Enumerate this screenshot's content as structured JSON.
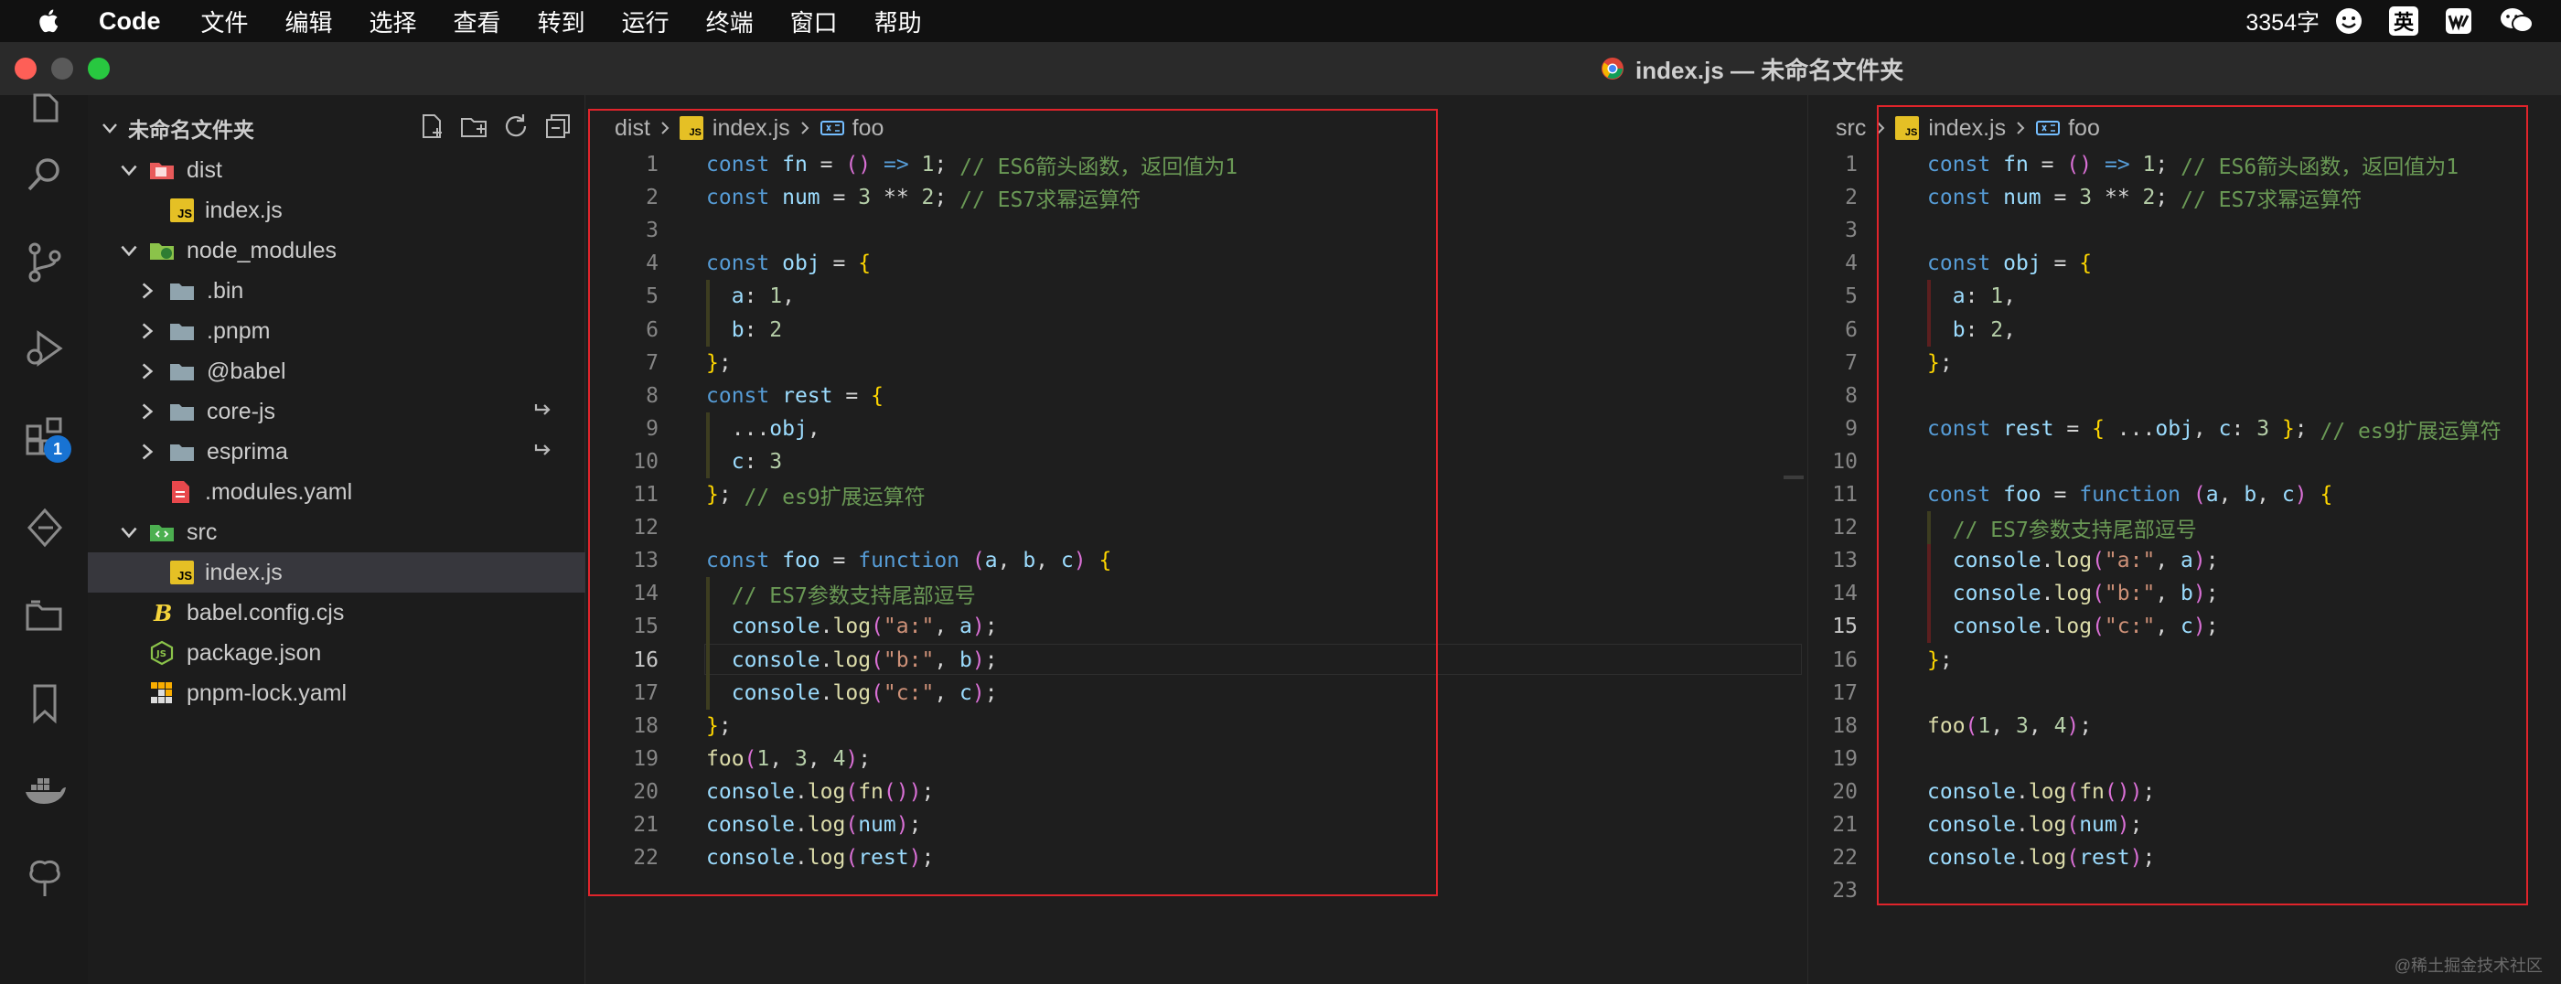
{
  "menubar": {
    "app": "Code",
    "items": [
      "文件",
      "编辑",
      "选择",
      "查看",
      "转到",
      "运行",
      "终端",
      "窗口",
      "帮助"
    ],
    "word_count": "3354字",
    "ime": "英"
  },
  "window": {
    "title": "index.js — 未命名文件夹"
  },
  "activity": {
    "badge": "1"
  },
  "explorer": {
    "title": "未命名文件夹",
    "tree": [
      {
        "label": "dist",
        "kind": "folder-dist",
        "expanded": true
      },
      {
        "label": "index.js",
        "kind": "js"
      },
      {
        "label": "node_modules",
        "kind": "folder-node",
        "expanded": true
      },
      {
        "label": ".bin",
        "kind": "folder"
      },
      {
        "label": ".pnpm",
        "kind": "folder"
      },
      {
        "label": "@babel",
        "kind": "folder"
      },
      {
        "label": "core-js",
        "kind": "folder"
      },
      {
        "label": "esprima",
        "kind": "folder"
      },
      {
        "label": ".modules.yaml",
        "kind": "yaml"
      },
      {
        "label": "src",
        "kind": "folder-src",
        "expanded": true
      },
      {
        "label": "index.js",
        "kind": "js"
      },
      {
        "label": "babel.config.cjs",
        "kind": "babel"
      },
      {
        "label": "package.json",
        "kind": "node"
      },
      {
        "label": "pnpm-lock.yaml",
        "kind": "pnpm"
      }
    ]
  },
  "left_editor": {
    "breadcrumb": {
      "folder": "dist",
      "file": "index.js",
      "symbol": "foo"
    },
    "active_line": "16",
    "lines": [
      {
        "n": "1",
        "code": "const fn = () => 1; // ES6箭头函数，返回值为1"
      },
      {
        "n": "2",
        "code": "const num = 3 ** 2; // ES7求幂运算符"
      },
      {
        "n": "3",
        "code": ""
      },
      {
        "n": "4",
        "code": "const obj = {"
      },
      {
        "n": "5",
        "code": "  a: 1,"
      },
      {
        "n": "6",
        "code": "  b: 2"
      },
      {
        "n": "7",
        "code": "};"
      },
      {
        "n": "8",
        "code": "const rest = {"
      },
      {
        "n": "9",
        "code": "  ...obj,"
      },
      {
        "n": "10",
        "code": "  c: 3"
      },
      {
        "n": "11",
        "code": "}; // es9扩展运算符"
      },
      {
        "n": "12",
        "code": ""
      },
      {
        "n": "13",
        "code": "const foo = function (a, b, c) {"
      },
      {
        "n": "14",
        "code": "  // ES7参数支持尾部逗号"
      },
      {
        "n": "15",
        "code": "  console.log(\"a:\", a);"
      },
      {
        "n": "16",
        "code": "  console.log(\"b:\", b);"
      },
      {
        "n": "17",
        "code": "  console.log(\"c:\", c);"
      },
      {
        "n": "18",
        "code": "};"
      },
      {
        "n": "19",
        "code": "foo(1, 3, 4);"
      },
      {
        "n": "20",
        "code": "console.log(fn());"
      },
      {
        "n": "21",
        "code": "console.log(num);"
      },
      {
        "n": "22",
        "code": "console.log(rest);"
      }
    ]
  },
  "right_editor": {
    "breadcrumb": {
      "folder": "src",
      "file": "index.js",
      "symbol": "foo"
    },
    "active_line": "15",
    "lines": [
      {
        "n": "1",
        "code": "const fn = () => 1; // ES6箭头函数，返回值为1"
      },
      {
        "n": "2",
        "code": "const num = 3 ** 2; // ES7求幂运算符"
      },
      {
        "n": "3",
        "code": ""
      },
      {
        "n": "4",
        "code": "const obj = {"
      },
      {
        "n": "5",
        "code": "  a: 1,"
      },
      {
        "n": "6",
        "code": "  b: 2,"
      },
      {
        "n": "7",
        "code": "};"
      },
      {
        "n": "8",
        "code": ""
      },
      {
        "n": "9",
        "code": "const rest = { ...obj, c: 3 }; // es9扩展运算符"
      },
      {
        "n": "10",
        "code": ""
      },
      {
        "n": "11",
        "code": "const foo = function (a, b, c) {"
      },
      {
        "n": "12",
        "code": "  // ES7参数支持尾部逗号"
      },
      {
        "n": "13",
        "code": "  console.log(\"a:\", a);"
      },
      {
        "n": "14",
        "code": "  console.log(\"b:\", b);"
      },
      {
        "n": "15",
        "code": "  console.log(\"c:\", c);"
      },
      {
        "n": "16",
        "code": "};"
      },
      {
        "n": "17",
        "code": ""
      },
      {
        "n": "18",
        "code": "foo(1, 3, 4);"
      },
      {
        "n": "19",
        "code": ""
      },
      {
        "n": "20",
        "code": "console.log(fn());"
      },
      {
        "n": "21",
        "code": "console.log(num);"
      },
      {
        "n": "22",
        "code": "console.log(rest);"
      },
      {
        "n": "23",
        "code": ""
      }
    ]
  },
  "watermark": "@稀土掘金技术社区",
  "colors": {
    "highlight_box": "#e0242b",
    "selection": "#37373d",
    "badge": "#1873d3"
  }
}
